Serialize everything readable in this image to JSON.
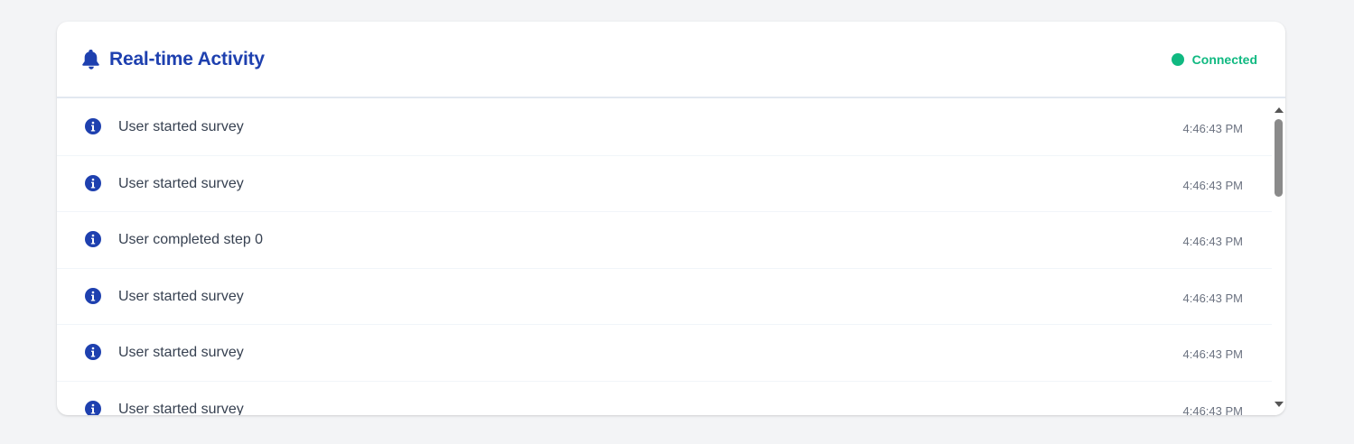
{
  "header": {
    "title": "Real-time Activity",
    "icon": "bell-icon",
    "status": {
      "label": "Connected",
      "color": "#10b981"
    }
  },
  "colors": {
    "accent": "#1e40af",
    "status_connected": "#10b981",
    "text": "#374151",
    "muted": "#6b7280",
    "background": "#f3f4f6"
  },
  "activity": {
    "items": [
      {
        "icon": "info-icon",
        "text": "User started survey",
        "time": "4:46:43 PM"
      },
      {
        "icon": "info-icon",
        "text": "User started survey",
        "time": "4:46:43 PM"
      },
      {
        "icon": "info-icon",
        "text": "User completed step 0",
        "time": "4:46:43 PM"
      },
      {
        "icon": "info-icon",
        "text": "User started survey",
        "time": "4:46:43 PM"
      },
      {
        "icon": "info-icon",
        "text": "User started survey",
        "time": "4:46:43 PM"
      },
      {
        "icon": "info-icon",
        "text": "User started survey",
        "time": "4:46:43 PM"
      }
    ]
  }
}
